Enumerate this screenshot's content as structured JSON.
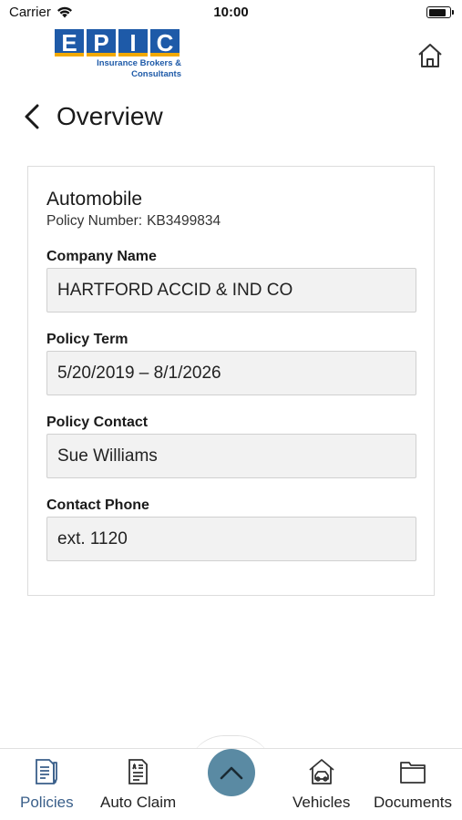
{
  "status_bar": {
    "carrier": "Carrier",
    "time": "10:00",
    "battery_level": 0.9
  },
  "header": {
    "logo": {
      "letters": [
        "E",
        "P",
        "I",
        "C"
      ],
      "tagline_line1": "Insurance Brokers &",
      "tagline_line2": "Consultants",
      "colors": {
        "primary": "#1e5aa8",
        "accent": "#f2a900"
      }
    },
    "home_icon": "home-icon",
    "back_icon": "chevron-left-icon",
    "title": "Overview"
  },
  "policy": {
    "type": "Automobile",
    "number_label": "Policy Number:",
    "number": "KB3499834",
    "fields": [
      {
        "label": "Company Name",
        "value": "HARTFORD ACCID & IND CO"
      },
      {
        "label": "Policy Term",
        "value": "5/20/2019 – 8/1/2026"
      },
      {
        "label": "Policy Contact",
        "value": "Sue Williams"
      },
      {
        "label": "Contact Phone",
        "value": "ext. 1120"
      }
    ]
  },
  "tab_bar": {
    "tabs": [
      {
        "label": "Policies",
        "icon": "policies-icon",
        "active": true
      },
      {
        "label": "Auto Claim",
        "icon": "auto-claim-icon",
        "active": false
      },
      {
        "label": "Vehicles",
        "icon": "vehicles-icon",
        "active": false
      },
      {
        "label": "Documents",
        "icon": "documents-icon",
        "active": false
      }
    ],
    "center_button_icon": "chevron-up-icon",
    "active_color": "#3a5f8a",
    "center_color": "#5a8aa3"
  }
}
